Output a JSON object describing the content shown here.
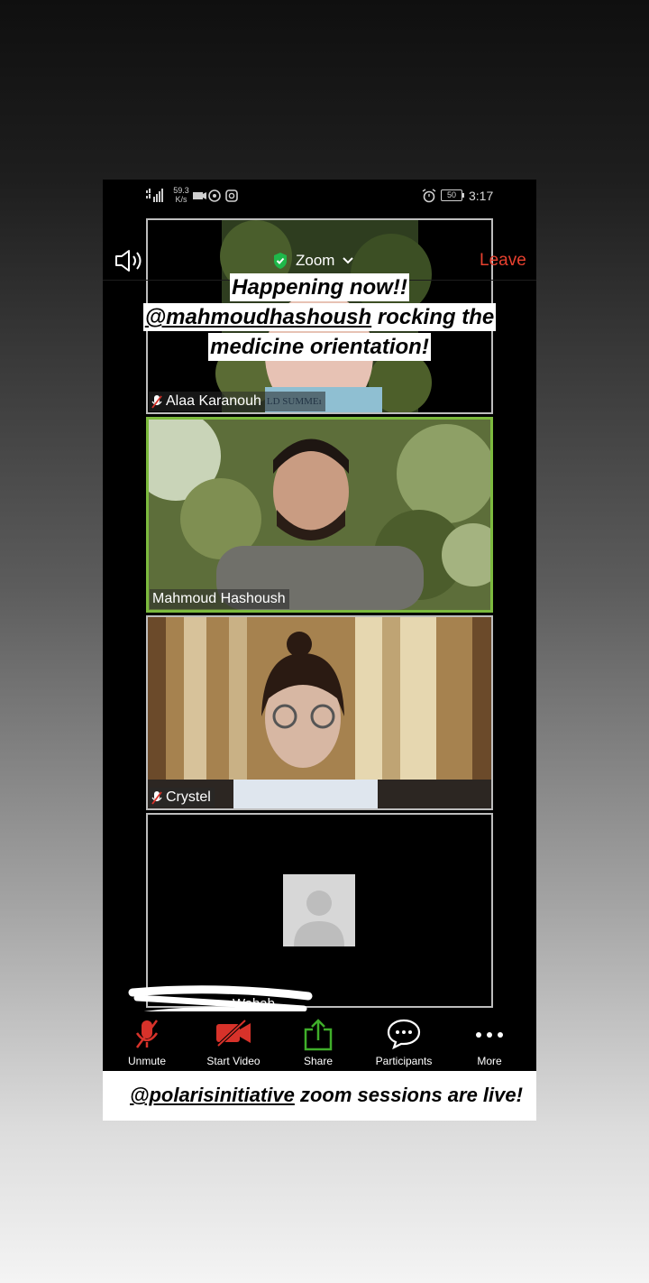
{
  "status_bar": {
    "net_speed_value": "59.3",
    "net_speed_unit": "K/s",
    "battery": "50",
    "time": "3:17"
  },
  "meeting": {
    "app_title": "Zoom",
    "leave_label": "Leave"
  },
  "story_overlay": {
    "line1": "Happening now!!",
    "line2_mention": "@mahmoudhashoush",
    "line2_rest": " rocking the",
    "line3": "medicine orientation!"
  },
  "participants": [
    {
      "name": "Alaa Karanouh",
      "muted": true,
      "shirt_text": "LD SUMMEı"
    },
    {
      "name": "Mahmoud Hashoush",
      "muted": false,
      "active_speaker": true
    },
    {
      "name": "Crystel",
      "muted": true
    },
    {
      "name": "Wahab",
      "muted": true,
      "video_off": true
    }
  ],
  "toolbar": {
    "unmute_label": "Unmute",
    "start_video_label": "Start Video",
    "share_label": "Share",
    "participants_label": "Participants",
    "more_label": "More"
  },
  "caption": {
    "mention": "@polarisinitiative",
    "rest": " zoom sessions are live!"
  },
  "colors": {
    "leave": "#e8412f",
    "active_border": "#7cba3e",
    "share_green": "#3fae2a",
    "muted_red": "#d7322a"
  }
}
